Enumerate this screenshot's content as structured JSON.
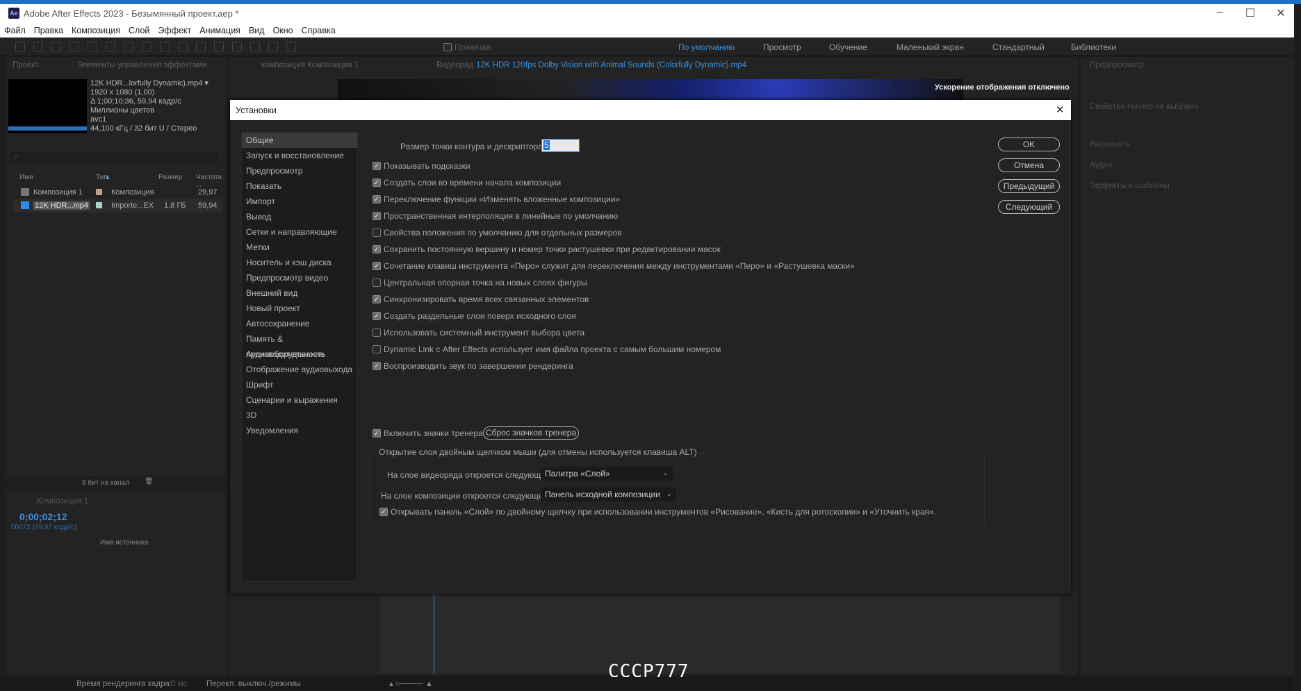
{
  "app": {
    "title": "Adobe After Effects 2023 - Безымянный проект.aep *",
    "logo": "Ae"
  },
  "menu": [
    "Файл",
    "Правка",
    "Композиция",
    "Слой",
    "Эффект",
    "Анимация",
    "Вид",
    "Окно",
    "Справка"
  ],
  "toolbar": {
    "snap_label": "Привязка"
  },
  "workspaces": [
    "По умолчанию",
    "Просмотр",
    "Обучение",
    "Маленький экран",
    "Стандартный",
    "Библиотеки"
  ],
  "project_panel": {
    "tabs": [
      "Проект",
      "Элементы управления эффектами"
    ],
    "info": [
      "12K HDR...lorfully Dynamic).mp4 ▾",
      "1920 x 1080 (1,00)",
      "Δ 1;00;10;36, 59,94 кадр/с",
      "Миллионы цветов",
      "avc1",
      "44,100 кГц / 32 бит U / Стерео"
    ],
    "columns": [
      "Имя",
      "Тип",
      "Размер",
      "Частота ..."
    ],
    "rows": [
      {
        "name": "Композиция 1",
        "type": "Композиция",
        "size": "",
        "rate": "29,97",
        "color": "#b5a68a"
      },
      {
        "name": "12K HDR...mp4",
        "type": "Importe...EX",
        "size": "1,8 ГБ",
        "rate": "59,94",
        "color": "#a6d2c8"
      }
    ],
    "bit_depth": "8 бит на канал"
  },
  "viewer": {
    "tabs": [
      "композиция Композиция 1",
      "Видеоряд"
    ],
    "footage_name": "12K HDR 120fps Dolby Vision with Animal Sounds (Colorfully Dynamic).mp4",
    "notice": "Ускорение отображения отключено"
  },
  "timeline": {
    "tab": "Композиция 1",
    "timecode": "0;00;02;12",
    "frames": "00072 (29.97 кадр/с)",
    "source_col": "Имя источника"
  },
  "right_panels": [
    "Предпросмотр",
    "Свойства  Ничего не выбрано",
    "Выровнять",
    "Аудио",
    "Эффекты и шаблоны"
  ],
  "status": {
    "render_label": "Время рендеринга кадра:",
    "render_value": "0 мс",
    "toggle": "Перекл. выключ./режимы"
  },
  "watermark": "CCCP777",
  "dialog": {
    "title": "Установки",
    "categories": [
      "Общие",
      "Запуск и восстановление",
      "Предпросмотр",
      "Показать",
      "Импорт",
      "Вывод",
      "Сетки и направляющие",
      "Метки",
      "Носитель и кэш диска",
      "Предпросмотр видео",
      "Внешний вид",
      "Новый проект",
      "Автосохранение",
      "Память & производительность",
      "Аудиооборудование",
      "Отображение аудиовыхода",
      "Шрифт",
      "Сценарии и выражения",
      "3D",
      "Уведомления"
    ],
    "selected_category": "Общие",
    "path_point_label": "Размер точки контура и дескриптора:",
    "path_point_value": "5",
    "options": [
      {
        "label": "Показывать подсказки",
        "checked": true
      },
      {
        "label": "Создать слои во времени начала композиции",
        "checked": true
      },
      {
        "label": "Переключение функции «Изменять вложенные композиции»",
        "checked": true
      },
      {
        "label": "Пространственная интерполяция в линейные по умолчанию",
        "checked": true
      },
      {
        "label": "Свойства положения по умолчанию для отдельных размеров",
        "checked": false
      },
      {
        "label": "Сохранить постоянную вершину и номер точки растушевки при редактировании масок",
        "checked": true
      },
      {
        "label": "Сочетание клавиш инструмента «Перо» служит для переключения между инструментами «Перо» и «Растушевка маски»",
        "checked": true
      },
      {
        "label": "Центральная опорная точка на новых слоях фигуры",
        "checked": false
      },
      {
        "label": "Синхронизировать время всех связанных элементов",
        "checked": true
      },
      {
        "label": "Создать раздельные слои поверх исходного слоя",
        "checked": true
      },
      {
        "label": "Использовать системный инструмент выбора цвета",
        "checked": false
      },
      {
        "label": "Dynamic Link с After Effects использует имя файла проекта с самым большим номером",
        "checked": false
      },
      {
        "label": "Воспроизводить звук по завершении рендеринга",
        "checked": true
      }
    ],
    "coach": {
      "label": "Включить значки тренера",
      "checked": true,
      "reset_button": "Сброс значков тренера"
    },
    "group": {
      "legend": "Открытие слоя двойным щелчком мыши (для отмены используется клавиша ALT)",
      "footage_label": "На слое видеоряда откроется следующее:",
      "footage_value": "Палитра «Слой»",
      "comp_label": "На слое композиции откроется следующее:",
      "comp_value": "Панель исходной композиции",
      "paint_label": "Открывать панель «Слой» по двойному щелчку при использовании инструментов «Рисование», «Кисть для ротоскопии» и «Уточнить края».",
      "paint_checked": true
    },
    "buttons": [
      "OK",
      "Отмена",
      "Предыдущий",
      "Следующий"
    ]
  },
  "colors": {
    "accent": "#2d8ceb",
    "panel": "#232323",
    "dialog_title": "#ffffff"
  }
}
